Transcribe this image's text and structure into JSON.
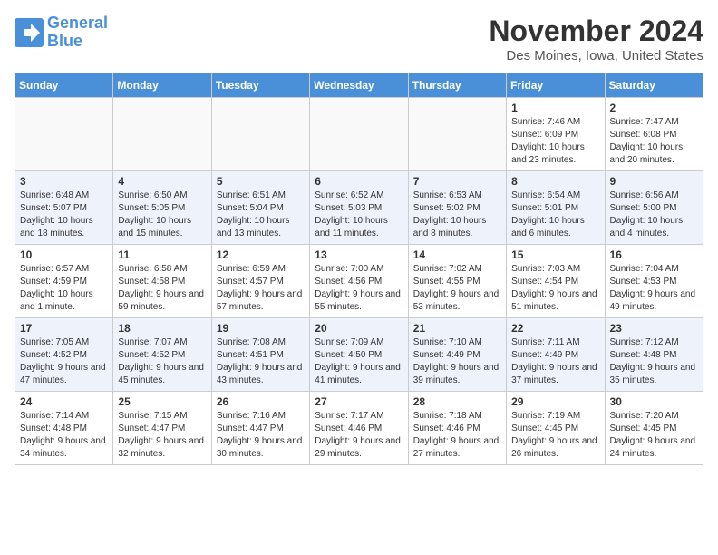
{
  "header": {
    "logo_line1": "General",
    "logo_line2": "Blue",
    "month_title": "November 2024",
    "location": "Des Moines, Iowa, United States"
  },
  "days_of_week": [
    "Sunday",
    "Monday",
    "Tuesday",
    "Wednesday",
    "Thursday",
    "Friday",
    "Saturday"
  ],
  "weeks": [
    [
      {
        "day": "",
        "info": ""
      },
      {
        "day": "",
        "info": ""
      },
      {
        "day": "",
        "info": ""
      },
      {
        "day": "",
        "info": ""
      },
      {
        "day": "",
        "info": ""
      },
      {
        "day": "1",
        "info": "Sunrise: 7:46 AM\nSunset: 6:09 PM\nDaylight: 10 hours and 23 minutes."
      },
      {
        "day": "2",
        "info": "Sunrise: 7:47 AM\nSunset: 6:08 PM\nDaylight: 10 hours and 20 minutes."
      }
    ],
    [
      {
        "day": "3",
        "info": "Sunrise: 6:48 AM\nSunset: 5:07 PM\nDaylight: 10 hours and 18 minutes."
      },
      {
        "day": "4",
        "info": "Sunrise: 6:50 AM\nSunset: 5:05 PM\nDaylight: 10 hours and 15 minutes."
      },
      {
        "day": "5",
        "info": "Sunrise: 6:51 AM\nSunset: 5:04 PM\nDaylight: 10 hours and 13 minutes."
      },
      {
        "day": "6",
        "info": "Sunrise: 6:52 AM\nSunset: 5:03 PM\nDaylight: 10 hours and 11 minutes."
      },
      {
        "day": "7",
        "info": "Sunrise: 6:53 AM\nSunset: 5:02 PM\nDaylight: 10 hours and 8 minutes."
      },
      {
        "day": "8",
        "info": "Sunrise: 6:54 AM\nSunset: 5:01 PM\nDaylight: 10 hours and 6 minutes."
      },
      {
        "day": "9",
        "info": "Sunrise: 6:56 AM\nSunset: 5:00 PM\nDaylight: 10 hours and 4 minutes."
      }
    ],
    [
      {
        "day": "10",
        "info": "Sunrise: 6:57 AM\nSunset: 4:59 PM\nDaylight: 10 hours and 1 minute."
      },
      {
        "day": "11",
        "info": "Sunrise: 6:58 AM\nSunset: 4:58 PM\nDaylight: 9 hours and 59 minutes."
      },
      {
        "day": "12",
        "info": "Sunrise: 6:59 AM\nSunset: 4:57 PM\nDaylight: 9 hours and 57 minutes."
      },
      {
        "day": "13",
        "info": "Sunrise: 7:00 AM\nSunset: 4:56 PM\nDaylight: 9 hours and 55 minutes."
      },
      {
        "day": "14",
        "info": "Sunrise: 7:02 AM\nSunset: 4:55 PM\nDaylight: 9 hours and 53 minutes."
      },
      {
        "day": "15",
        "info": "Sunrise: 7:03 AM\nSunset: 4:54 PM\nDaylight: 9 hours and 51 minutes."
      },
      {
        "day": "16",
        "info": "Sunrise: 7:04 AM\nSunset: 4:53 PM\nDaylight: 9 hours and 49 minutes."
      }
    ],
    [
      {
        "day": "17",
        "info": "Sunrise: 7:05 AM\nSunset: 4:52 PM\nDaylight: 9 hours and 47 minutes."
      },
      {
        "day": "18",
        "info": "Sunrise: 7:07 AM\nSunset: 4:52 PM\nDaylight: 9 hours and 45 minutes."
      },
      {
        "day": "19",
        "info": "Sunrise: 7:08 AM\nSunset: 4:51 PM\nDaylight: 9 hours and 43 minutes."
      },
      {
        "day": "20",
        "info": "Sunrise: 7:09 AM\nSunset: 4:50 PM\nDaylight: 9 hours and 41 minutes."
      },
      {
        "day": "21",
        "info": "Sunrise: 7:10 AM\nSunset: 4:49 PM\nDaylight: 9 hours and 39 minutes."
      },
      {
        "day": "22",
        "info": "Sunrise: 7:11 AM\nSunset: 4:49 PM\nDaylight: 9 hours and 37 minutes."
      },
      {
        "day": "23",
        "info": "Sunrise: 7:12 AM\nSunset: 4:48 PM\nDaylight: 9 hours and 35 minutes."
      }
    ],
    [
      {
        "day": "24",
        "info": "Sunrise: 7:14 AM\nSunset: 4:48 PM\nDaylight: 9 hours and 34 minutes."
      },
      {
        "day": "25",
        "info": "Sunrise: 7:15 AM\nSunset: 4:47 PM\nDaylight: 9 hours and 32 minutes."
      },
      {
        "day": "26",
        "info": "Sunrise: 7:16 AM\nSunset: 4:47 PM\nDaylight: 9 hours and 30 minutes."
      },
      {
        "day": "27",
        "info": "Sunrise: 7:17 AM\nSunset: 4:46 PM\nDaylight: 9 hours and 29 minutes."
      },
      {
        "day": "28",
        "info": "Sunrise: 7:18 AM\nSunset: 4:46 PM\nDaylight: 9 hours and 27 minutes."
      },
      {
        "day": "29",
        "info": "Sunrise: 7:19 AM\nSunset: 4:45 PM\nDaylight: 9 hours and 26 minutes."
      },
      {
        "day": "30",
        "info": "Sunrise: 7:20 AM\nSunset: 4:45 PM\nDaylight: 9 hours and 24 minutes."
      }
    ]
  ]
}
